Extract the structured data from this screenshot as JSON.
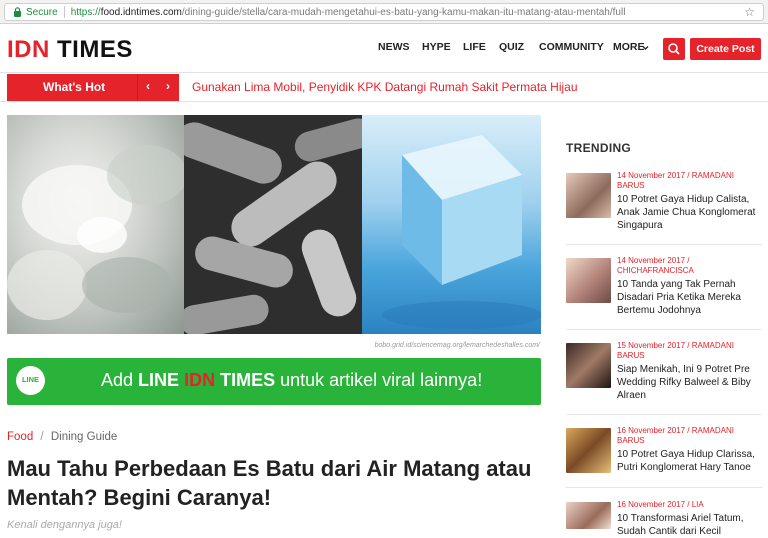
{
  "browser": {
    "secure_label": "Secure",
    "url_scheme": "https://",
    "url_host": "food.idntimes.com",
    "url_path": "/dining-guide/stella/cara-mudah-mengetahui-es-batu-yang-kamu-makan-itu-matang-atau-mentah/full"
  },
  "header": {
    "logo_idn": "IDN",
    "logo_times": "TIMES",
    "nav": [
      "NEWS",
      "HYPE",
      "LIFE",
      "QUIZ",
      "COMMUNITY",
      "MORE"
    ],
    "create_post": "Create Post",
    "accent": "#e5232a"
  },
  "hot": {
    "label": "What's Hot",
    "headline": "Gunakan Lima Mobil, Penyidik KPK Datangi Rumah Sakit Permata Hijau"
  },
  "hero": {
    "credit": "bobo.grid.id/sciencemag.org/lemarchedeshalles.com/"
  },
  "line_banner": {
    "pre": "Add ",
    "line": "LINE",
    "idn": "IDN",
    "times": "TIMES",
    "post": " untuk artikel viral lainnya!",
    "icon_text": "LINE"
  },
  "article": {
    "breadcrumb_category": "Food",
    "breadcrumb_sep": "/",
    "breadcrumb_sub": "Dining Guide",
    "title": "Mau Tahu Perbedaan Es Batu dari Air Matang atau Mentah? Begini Caranya!",
    "subtitle": "Kenali dengannya juga!"
  },
  "trending": {
    "heading": "TRENDING",
    "items": [
      {
        "date": "14 November 2017",
        "author": "RAMADANI BARUS",
        "title": "10 Potret Gaya Hidup Calista, Anak Jamie Chua Konglomerat Singapura"
      },
      {
        "date": "14 November 2017",
        "author": "CHICHAFRANCISCA",
        "title": "10 Tanda yang Tak Pernah Disadari Pria Ketika Mereka Bertemu Jodohnya"
      },
      {
        "date": "15 November 2017",
        "author": "RAMADANI BARUS",
        "title": "Siap Menikah, Ini 9 Potret Pre Wedding Rifky Balweel & Biby Alraen"
      },
      {
        "date": "16 November 2017",
        "author": "RAMADANI BARUS",
        "title": "10 Potret Gaya Hidup Clarissa, Putri Konglomerat Hary Tanoe"
      },
      {
        "date": "16 November 2017",
        "author": "LIA",
        "title": "10 Transformasi Ariel Tatum, Sudah Cantik dari Kecil"
      }
    ]
  }
}
